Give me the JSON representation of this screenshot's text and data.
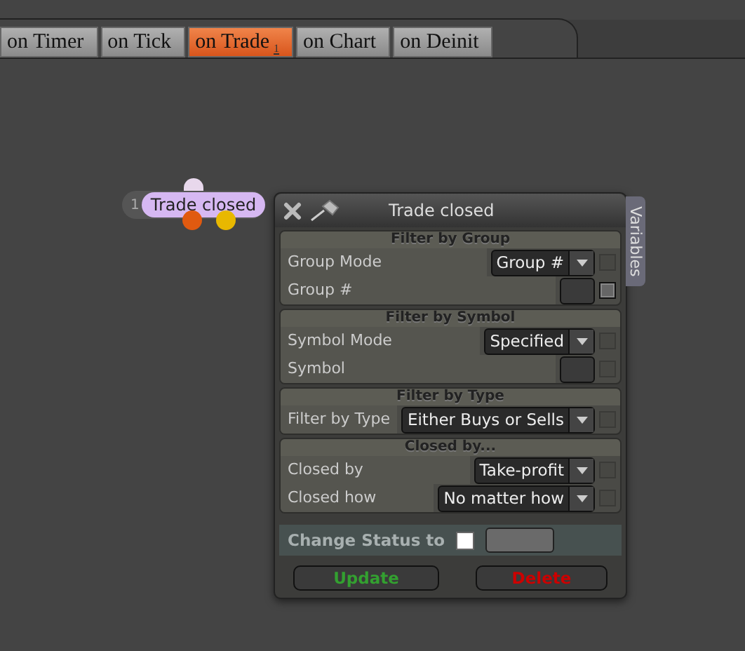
{
  "tabs": [
    {
      "label": "on Timer",
      "selected": false
    },
    {
      "label": "on Tick",
      "selected": false
    },
    {
      "label": "on Trade",
      "selected": true,
      "badge": "1"
    },
    {
      "label": "on Chart",
      "selected": false
    },
    {
      "label": "on Deinit",
      "selected": false
    }
  ],
  "node": {
    "number": "1",
    "label": "Trade closed"
  },
  "panel": {
    "title": "Trade closed",
    "side_tab": "Variables",
    "sections": [
      {
        "title": "Filter by Group",
        "rows": [
          {
            "label": "Group Mode",
            "kind": "select",
            "value": "Group #",
            "checkbox_enabled": false
          },
          {
            "label": "Group #",
            "kind": "field",
            "checkbox_enabled": true
          }
        ]
      },
      {
        "title": "Filter by Symbol",
        "rows": [
          {
            "label": "Symbol Mode",
            "kind": "select",
            "value": "Specified",
            "checkbox_enabled": false
          },
          {
            "label": "Symbol",
            "kind": "field",
            "checkbox_enabled": false
          }
        ]
      },
      {
        "title": "Filter by Type",
        "rows": [
          {
            "label": "Filter by Type",
            "kind": "select",
            "value": "Either Buys or Sells",
            "checkbox_enabled": false
          }
        ]
      },
      {
        "title": "Closed by...",
        "rows": [
          {
            "label": "Closed by",
            "kind": "select",
            "value": "Take-profit",
            "checkbox_enabled": false
          },
          {
            "label": "Closed how",
            "kind": "select",
            "value": "No matter how",
            "checkbox_enabled": false
          }
        ]
      }
    ],
    "change_status": {
      "label": "Change Status to",
      "checked": false
    },
    "buttons": [
      {
        "label": "Update",
        "kind": "update"
      },
      {
        "label": "Delete",
        "kind": "delete"
      }
    ]
  }
}
